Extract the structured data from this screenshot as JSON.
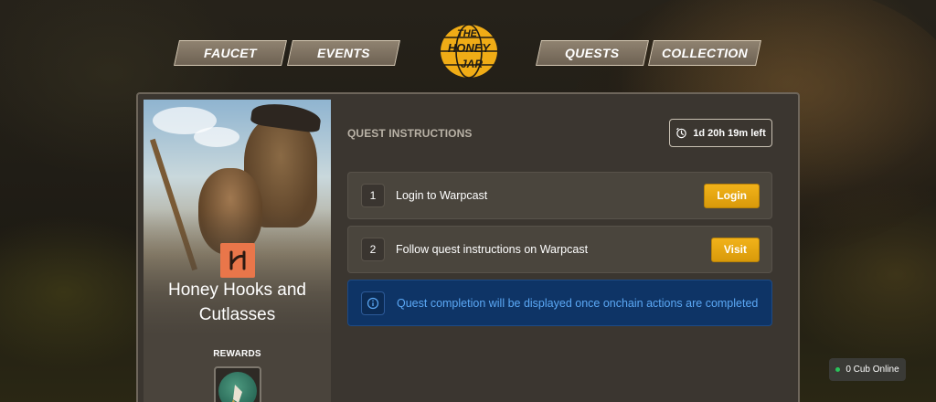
{
  "nav": {
    "left": [
      {
        "label": "FAUCET"
      },
      {
        "label": "EVENTS"
      }
    ],
    "right": [
      {
        "label": "QUESTS"
      },
      {
        "label": "COLLECTION"
      }
    ],
    "logo_text": [
      "THE",
      "HONEY",
      "JAR"
    ]
  },
  "quest": {
    "title": "Honey Hooks and Cutlasses",
    "rewards_label": "REWARDS"
  },
  "instructions": {
    "title": "QUEST INSTRUCTIONS",
    "time_left": "1d 20h 19m left",
    "steps": [
      {
        "number": "1",
        "text": "Login to Warpcast",
        "button": "Login"
      },
      {
        "number": "2",
        "text": "Follow quest instructions on Warpcast",
        "button": "Visit"
      }
    ],
    "info": "Quest completion will be displayed once onchain actions are completed"
  },
  "status": {
    "online_text": "0 Cub Online"
  },
  "colors": {
    "accent": "#F0AC16",
    "info_bg": "#0E3466",
    "info_text": "#5BA8F5",
    "quest_icon": "#E9764A"
  }
}
